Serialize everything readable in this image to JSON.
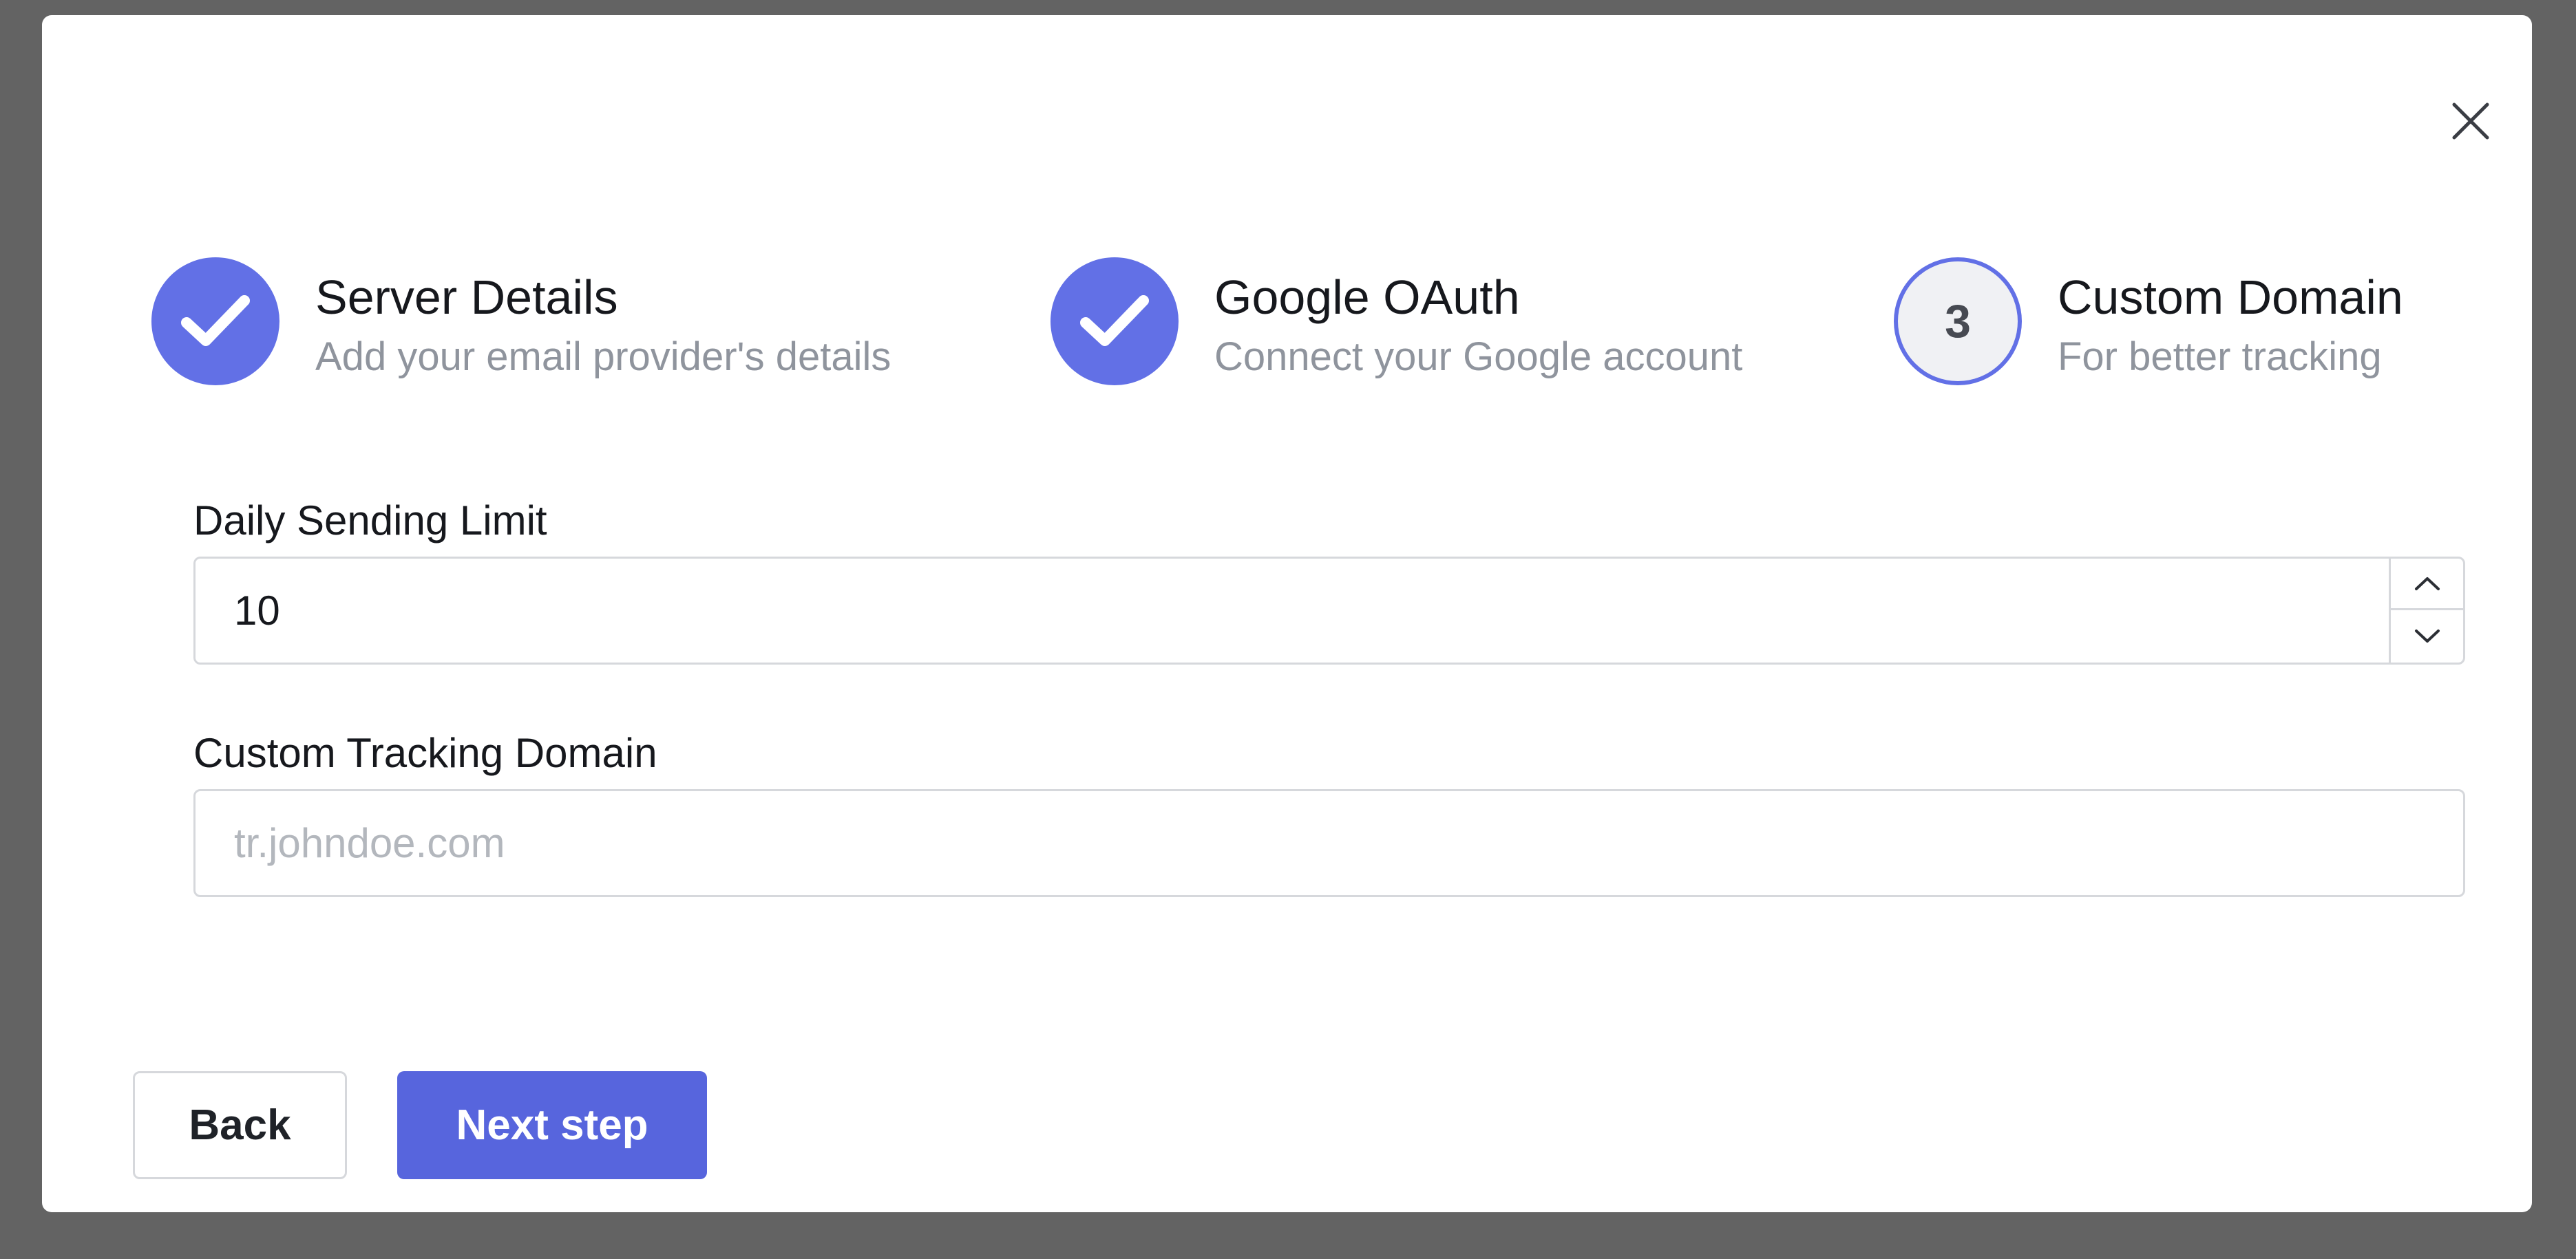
{
  "modal": {
    "close_icon": "close-icon"
  },
  "steps": [
    {
      "title": "Server Details",
      "subtitle": "Add your email provider's details",
      "state": "done",
      "icon": "check-icon"
    },
    {
      "title": "Google OAuth",
      "subtitle": "Connect your Google account",
      "state": "done",
      "icon": "check-icon"
    },
    {
      "title": "Custom Domain",
      "subtitle": "For better tracking",
      "state": "current",
      "number": "3"
    }
  ],
  "form": {
    "daily_limit": {
      "label": "Daily Sending Limit",
      "value": "10"
    },
    "tracking_domain": {
      "label": "Custom Tracking Domain",
      "value": "",
      "placeholder": "tr.johndoe.com"
    }
  },
  "actions": {
    "back_label": "Back",
    "next_label": "Next step"
  },
  "colors": {
    "accent": "#6270e6",
    "primary_button": "#5765dd",
    "backdrop": "#636363"
  }
}
